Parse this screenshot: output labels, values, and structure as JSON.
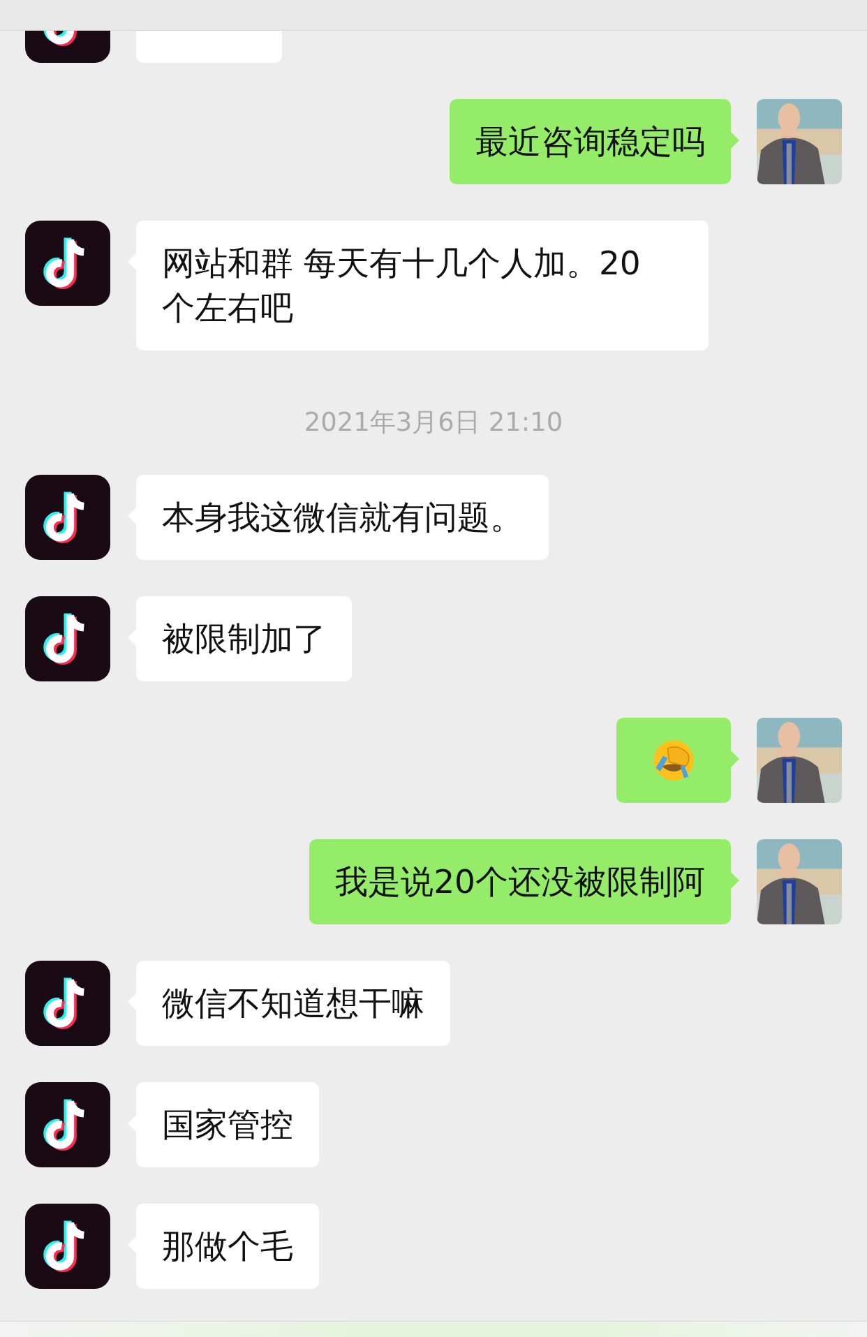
{
  "messages": [
    {
      "outgoing": false,
      "kind": "cut"
    },
    {
      "outgoing": true,
      "kind": "text",
      "text": "最近咨询稳定吗"
    },
    {
      "outgoing": false,
      "kind": "text",
      "text": "网站和群 每天有十几个人加。20 个左右吧"
    },
    {
      "kind": "time",
      "text": "2021年3月6日 21:10"
    },
    {
      "outgoing": false,
      "kind": "text",
      "text": "本身我这微信就有问题。"
    },
    {
      "outgoing": false,
      "kind": "text",
      "text": "被限制加了"
    },
    {
      "outgoing": true,
      "kind": "emoji"
    },
    {
      "outgoing": true,
      "kind": "text",
      "text": "我是说20个还没被限制阿"
    },
    {
      "outgoing": false,
      "kind": "text",
      "text": "微信不知道想干嘛"
    },
    {
      "outgoing": false,
      "kind": "text",
      "text": "国家管控"
    },
    {
      "outgoing": false,
      "kind": "text",
      "text": "那做个毛"
    }
  ]
}
